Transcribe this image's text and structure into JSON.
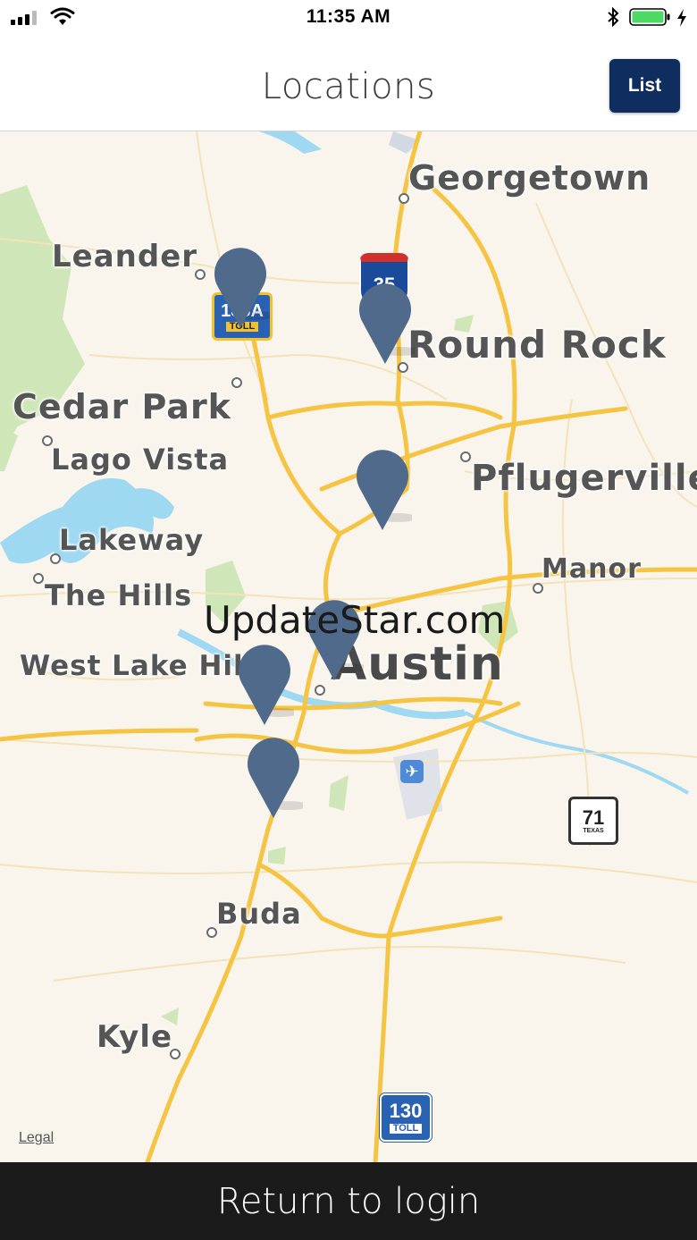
{
  "status_bar": {
    "time": "11:35 AM",
    "signal_icon": "cellular-signal-icon",
    "wifi_icon": "wifi-icon",
    "bluetooth_icon": "bluetooth-icon",
    "battery_icon": "battery-icon",
    "charging_icon": "charging-bolt-icon",
    "battery_color": "#4cd964"
  },
  "header": {
    "title": "Locations",
    "list_button": "List",
    "button_color": "#0f2d5e"
  },
  "map": {
    "cities": [
      {
        "name": "Georgetown"
      },
      {
        "name": "Leander"
      },
      {
        "name": "Round Rock"
      },
      {
        "name": "Cedar Park"
      },
      {
        "name": "Lago Vista"
      },
      {
        "name": "Pflugerville"
      },
      {
        "name": "Lakeway"
      },
      {
        "name": "Manor"
      },
      {
        "name": "The Hills"
      },
      {
        "name": "Austin"
      },
      {
        "name": "West Lake Hills"
      },
      {
        "name": "Buda"
      },
      {
        "name": "Kyle"
      }
    ],
    "route_shields": [
      "35",
      "183A",
      "TOLL",
      "71",
      "TEXAS",
      "130",
      "TOLL"
    ],
    "marker_count": 6,
    "marker_color": "#4f6a8a",
    "watermark": "UpdateStar.com",
    "legal": "Legal"
  },
  "footer": {
    "return_label": "Return to login"
  }
}
